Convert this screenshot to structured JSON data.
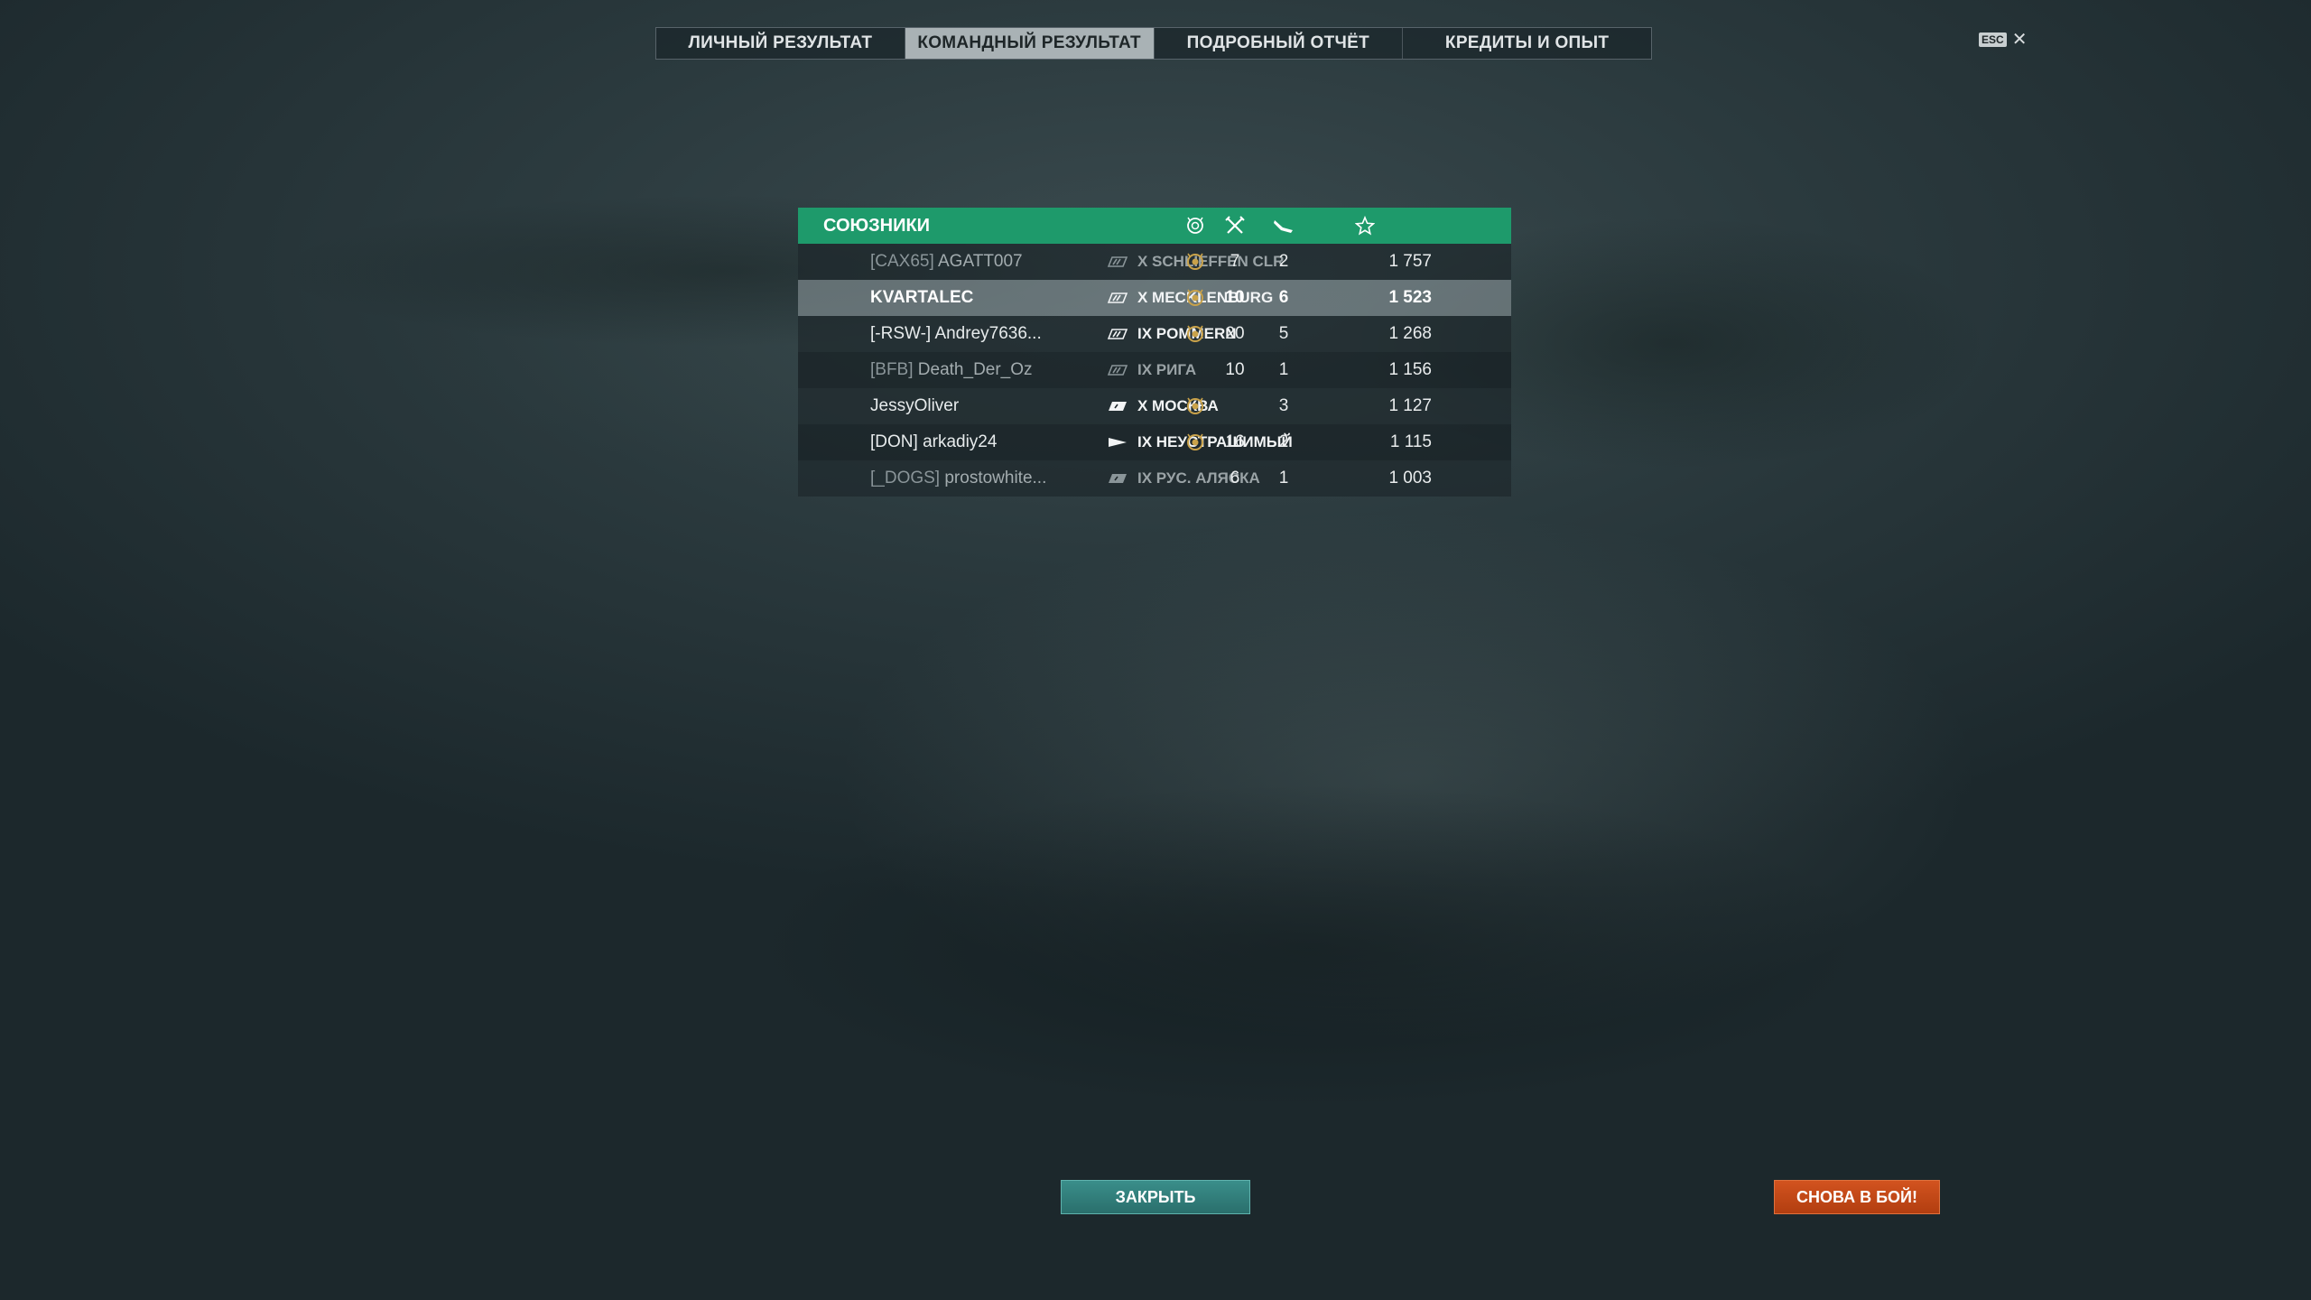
{
  "tabs": [
    {
      "label": "ЛИЧНЫЙ РЕЗУЛЬТАТ",
      "active": false
    },
    {
      "label": "КОМАНДНЫЙ РЕЗУЛЬТАТ",
      "active": true
    },
    {
      "label": "ПОДРОБНЫЙ ОТЧЁТ",
      "active": false
    },
    {
      "label": "КРЕДИТЫ И ОПЫТ",
      "active": false
    }
  ],
  "esc": {
    "key": "ESC",
    "close": "✕"
  },
  "team": {
    "title": "СОЮЗНИКИ",
    "header_icons": [
      "medal-icon",
      "kills-icon",
      "planes-icon",
      "star-icon"
    ],
    "players": [
      {
        "clan": "[CAX65]",
        "name": "AGATT007",
        "ship": "X  SCHLIEFFEN CLR",
        "ship_icon": "battleship-icon",
        "medal": true,
        "kills": "7",
        "planes": "2",
        "xp": "1 757",
        "dim": true,
        "highlight": false
      },
      {
        "clan": "",
        "name": "KVARTALEC",
        "ship": "X  MECKLENBURG",
        "ship_icon": "battleship-icon",
        "medal": true,
        "kills": "10",
        "planes": "6",
        "xp": "1 523",
        "dim": false,
        "highlight": true
      },
      {
        "clan": "[-RSW-]",
        "name": "Andrey7636...",
        "ship": "IX  POMMERN",
        "ship_icon": "battleship-icon",
        "medal": true,
        "kills": "20",
        "planes": "5",
        "xp": "1 268",
        "dim": false,
        "highlight": false
      },
      {
        "clan": "[BFB]",
        "name": "Death_Der_Oz",
        "ship": "IX  РИГА",
        "ship_icon": "battleship-icon",
        "medal": false,
        "kills": "10",
        "planes": "1",
        "xp": "1 156",
        "dim": true,
        "highlight": false
      },
      {
        "clan": "",
        "name": "JessyOliver",
        "ship": "X  МОСКВА",
        "ship_icon": "cruiser-icon",
        "medal": true,
        "kills": "",
        "planes": "3",
        "xp": "1 127",
        "dim": false,
        "highlight": false
      },
      {
        "clan": "[DON]",
        "name": "arkadiy24",
        "ship": "IX  НЕУСТРАШИМЫЙ",
        "ship_icon": "destroyer-icon",
        "medal": true,
        "kills": "16",
        "planes": "2",
        "xp": "1 115",
        "dim": false,
        "highlight": false
      },
      {
        "clan": "[_DOGS]",
        "name": "prostowhite...",
        "ship": "IX  РУС. АЛЯСКА",
        "ship_icon": "cruiser-icon",
        "medal": false,
        "kills": "6",
        "planes": "1",
        "xp": "1 003",
        "dim": true,
        "highlight": false
      }
    ]
  },
  "buttons": {
    "close": "ЗАКРЫТЬ",
    "again": "СНОВА В БОЙ!"
  }
}
